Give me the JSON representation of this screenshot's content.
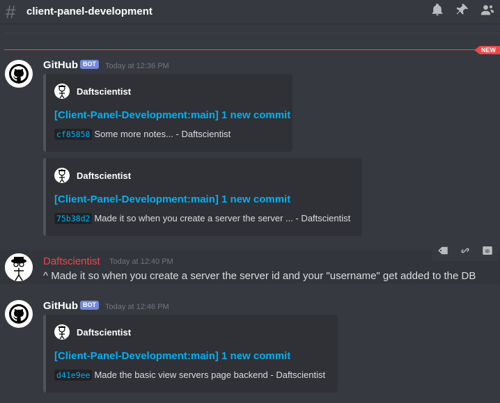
{
  "header": {
    "hash": "#",
    "channel_name": "client-panel-development",
    "icons": [
      "bell-icon",
      "pin-icon",
      "members-icon"
    ]
  },
  "divider": {
    "badge": "NEW"
  },
  "messages": [
    {
      "author": "GitHub",
      "tag": "BOT",
      "timestamp": "Today at 12:36 PM",
      "embeds": [
        {
          "author": "Daftscientist",
          "title": "[Client-Panel-Development:main] 1 new commit",
          "sha": "cf85858",
          "text": "Some more notes... - Daftscientist"
        },
        {
          "author": "Daftscientist",
          "title": "[Client-Panel-Development:main] 1 new commit",
          "sha": "75b38d2",
          "text": "Made it so when you create a server the server ... - Daftscientist"
        }
      ]
    },
    {
      "author": "Daftscientist",
      "timestamp": "Today at 12:40 PM",
      "content": "^ Made it so when you create a server the server id and your \"username\" get added to the DB",
      "author_color": "#f04747"
    },
    {
      "author": "GitHub",
      "tag": "BOT",
      "timestamp": "Today at 12:46 PM",
      "embeds": [
        {
          "author": "Daftscientist",
          "title": "[Client-Panel-Development:main] 1 new commit",
          "sha": "d41e9ee",
          "text": "Made the basic view servers page backend - Daftscientist"
        }
      ]
    }
  ],
  "hover_actions": [
    "tag-icon",
    "link-icon",
    "id-icon"
  ],
  "colors": {
    "background": "#36393f",
    "link": "#00b0f4",
    "new_red": "#f04747",
    "bot_tag": "#7289da"
  }
}
